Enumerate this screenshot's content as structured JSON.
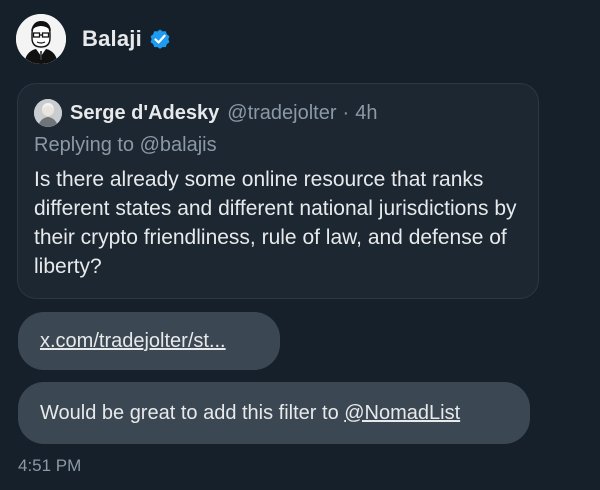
{
  "sender": {
    "name": "Balaji",
    "verified_color": "#1d9bf0",
    "avatar_icon": "avatar-sketch"
  },
  "quoted_post": {
    "author_name": "Serge d'Adesky",
    "handle": "@tradejolter",
    "separator": "·",
    "time": "4h",
    "replying_to": "Replying to @balajis",
    "text": "Is there already some online resource that ranks different states and different national jurisdictions by their crypto friendliness, rule of law, and defense of liberty?"
  },
  "messages": [
    {
      "link": "x.com/tradejolter/st..."
    },
    {
      "text": "Would be great to add this filter to ",
      "mention": "@NomadList"
    }
  ],
  "timestamp": "4:51 PM",
  "colors": {
    "background": "#15202b",
    "bubble": "#3b4752",
    "quote_card": "#1c2732",
    "muted_text": "#8b98a5"
  }
}
